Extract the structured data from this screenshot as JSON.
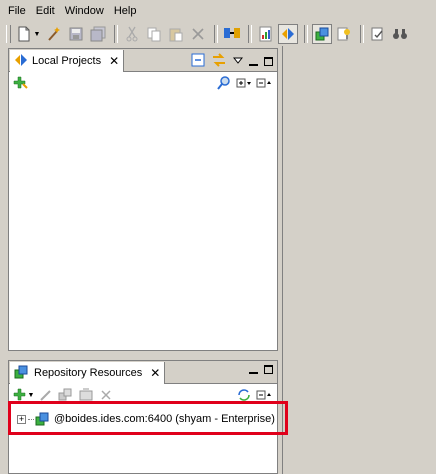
{
  "menubar": {
    "items": [
      "File",
      "Edit",
      "Window",
      "Help"
    ]
  },
  "toolbar": {
    "buttons": [
      "new-icon",
      "wand-icon",
      "save-icon",
      "save-all-icon",
      "cut-icon",
      "copy-icon",
      "paste-icon",
      "delete-icon",
      "connection-icon",
      "report-icon",
      "projects-icon",
      "repository-icon",
      "object-icon",
      "check-icon",
      "binoculars-icon"
    ]
  },
  "local_projects": {
    "title": "Local Projects",
    "close": "✕"
  },
  "repository_resources": {
    "title": "Repository Resources",
    "close": "✕",
    "tree": [
      {
        "label": "@boides.ides.com:6400 (shyam - Enterprise)",
        "expander": "+"
      }
    ]
  },
  "colors": {
    "highlight": "#e0001b",
    "chrome": "#d4d0c8",
    "border": "#808080"
  }
}
